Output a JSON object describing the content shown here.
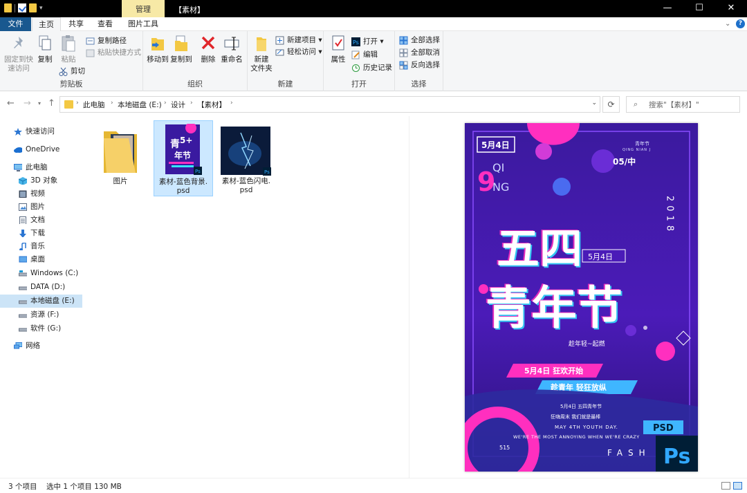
{
  "titlebar": {
    "context_tab": "管理",
    "title": "【素材】",
    "minimize": "—",
    "maximize": "☐",
    "close": "✕"
  },
  "tabs": {
    "file": "文件",
    "home": "主页",
    "share": "共享",
    "view": "查看",
    "picture_tools": "图片工具",
    "help": "⌄"
  },
  "ribbon": {
    "clipboard": {
      "pin_line1": "固定到快",
      "pin_line2": "速访问",
      "copy": "复制",
      "paste": "粘贴",
      "copy_path": "复制路径",
      "paste_shortcut": "粘贴快捷方式",
      "cut": "剪切",
      "label": "剪贴板"
    },
    "organize": {
      "move_to": "移动到",
      "copy_to": "复制到",
      "delete": "删除",
      "rename": "重命名",
      "label": "组织"
    },
    "new": {
      "new_folder_line1": "新建",
      "new_folder_line2": "文件夹",
      "new_item": "新建项目",
      "easy_access": "轻松访问",
      "label": "新建"
    },
    "open": {
      "properties": "属性",
      "open": "打开",
      "edit": "编辑",
      "history": "历史记录",
      "label": "打开"
    },
    "select": {
      "select_all": "全部选择",
      "select_none": "全部取消",
      "invert": "反向选择",
      "label": "选择"
    }
  },
  "address": {
    "crumbs": [
      "此电脑",
      "本地磁盘 (E:)",
      "设计",
      "【素材】"
    ],
    "search_placeholder": "搜索\"【素材】\""
  },
  "navpane": {
    "items": [
      {
        "label": "快速访问",
        "icon": "star-icon"
      },
      {
        "label": "OneDrive",
        "icon": "cloud-icon"
      },
      {
        "label": "此电脑",
        "icon": "computer-icon"
      },
      {
        "label": "3D 对象",
        "icon": "cube-icon"
      },
      {
        "label": "视频",
        "icon": "video-icon"
      },
      {
        "label": "图片",
        "icon": "picture-icon"
      },
      {
        "label": "文档",
        "icon": "document-icon"
      },
      {
        "label": "下载",
        "icon": "download-icon"
      },
      {
        "label": "音乐",
        "icon": "music-icon"
      },
      {
        "label": "桌面",
        "icon": "desktop-icon"
      },
      {
        "label": "Windows (C:)",
        "icon": "drive-icon"
      },
      {
        "label": "DATA (D:)",
        "icon": "drive-icon"
      },
      {
        "label": "本地磁盘 (E:)",
        "icon": "drive-icon"
      },
      {
        "label": "资源 (F:)",
        "icon": "drive-icon"
      },
      {
        "label": "软件 (G:)",
        "icon": "drive-icon"
      },
      {
        "label": "网络",
        "icon": "network-icon"
      }
    ]
  },
  "files": [
    {
      "name_line1": "图片",
      "name_line2": ""
    },
    {
      "name_line1": "素材-蓝色背景.",
      "name_line2": "psd"
    },
    {
      "name_line1": "素材-蓝色闪电.",
      "name_line2": "psd"
    }
  ],
  "preview": {
    "badge_date": "5月4日",
    "big_numeral": "9",
    "qi": "QI",
    "ng": "NG",
    "corner_title": "青年节",
    "corner_pinyin": "QING NIAN J",
    "corner_date": "05/中",
    "headline_top": "五四",
    "headline_bottom": "青年节",
    "headline_tag": "5月4日",
    "year_digits": "2018",
    "slogan_small": "趁年轻~起燃",
    "banner1": "5月4日 狂欢开始",
    "banner2": "趁青年 轻狂放纵",
    "line1": "5月4日 五四青年节",
    "line2": "狂嗨周末 我们就是最棒",
    "line3": "MAY 4TH YOUTH DAY.",
    "line4": "WE'RE THE MOST ANNOYING WHEN WE'RE CRAZY",
    "small_515": "515",
    "fash": "FASH",
    "psd_tag": "PSD",
    "ps_tag": "Ps",
    "accent_magenta": "#ff2fbf",
    "accent_cyan": "#33e6ff",
    "bg_purple": "#3b1a9e"
  },
  "status": {
    "count": "3 个项目",
    "selected": "选中 1 个项目  130 MB"
  }
}
